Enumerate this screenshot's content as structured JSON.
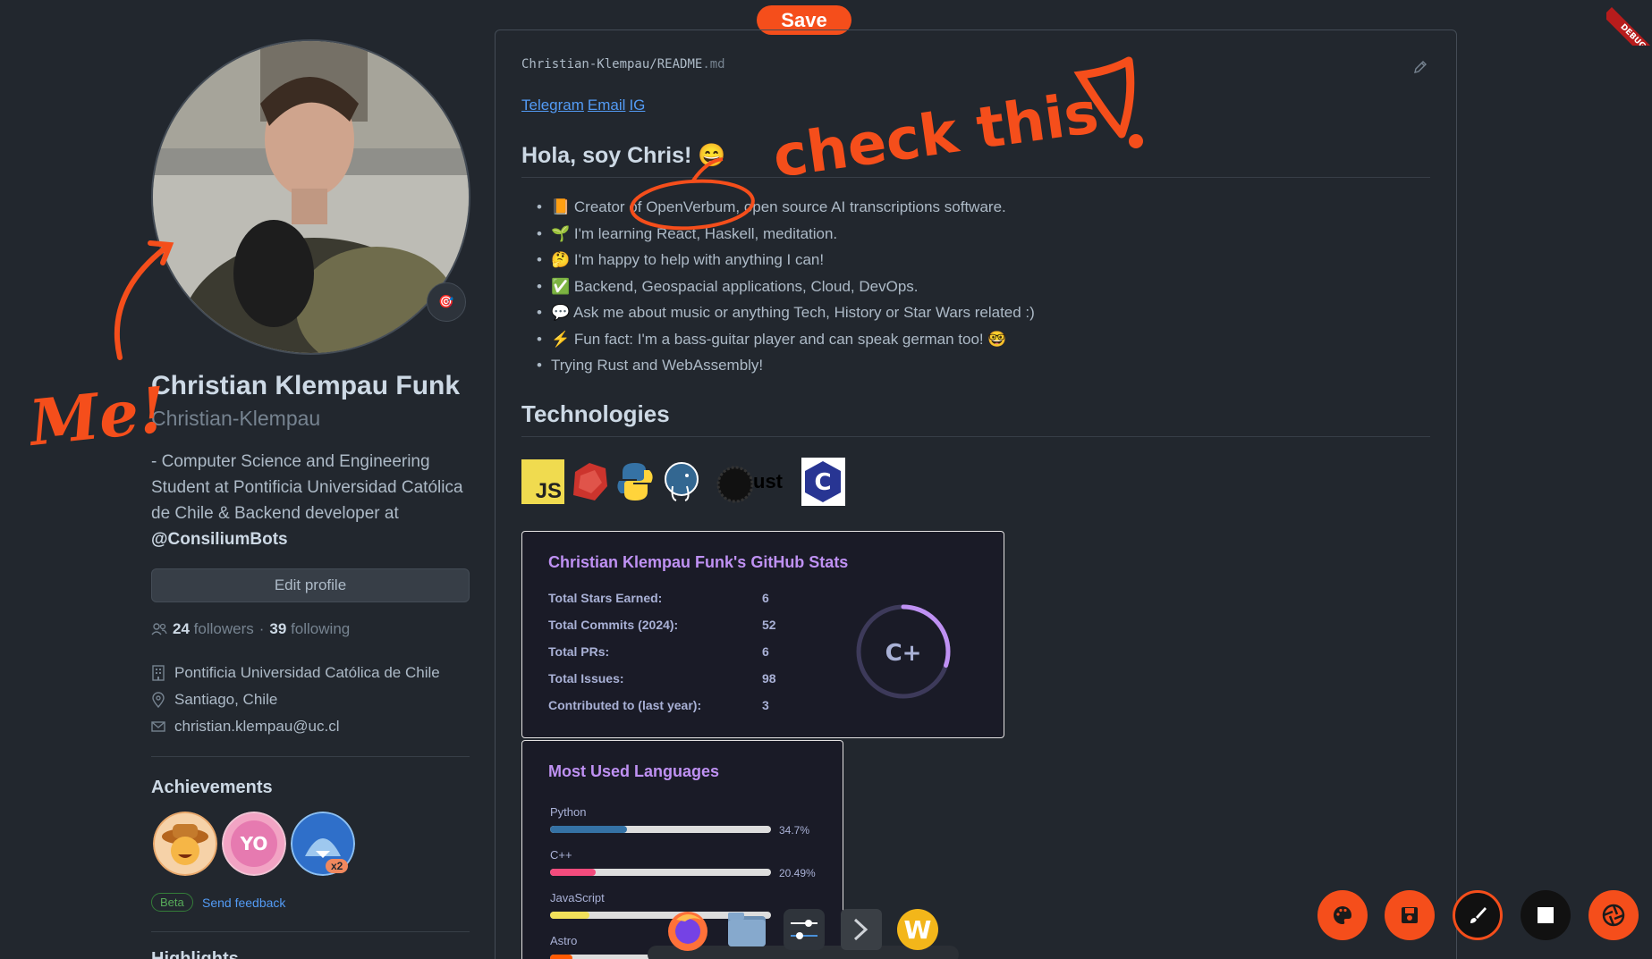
{
  "toolbar": {
    "save_label": "Save"
  },
  "profile": {
    "full_name": "Christian Klempau Funk",
    "username": "Christian-Klempau",
    "bio_text": "- Computer Science and Engineering Student at Pontificia Universidad Católica de Chile & Backend developer at ",
    "bio_org": "@ConsiliumBots",
    "edit_label": "Edit profile",
    "followers_count": "24",
    "followers_label": "followers",
    "separator": "·",
    "following_count": "39",
    "following_label": "following",
    "organization": "Pontificia Universidad Católica de Chile",
    "location": "Santiago, Chile",
    "email": "christian.klempau@uc.cl",
    "achievements_title": "Achievements",
    "achievement_multiplier": "x2",
    "beta_label": "Beta",
    "feedback_label": "Send feedback",
    "highlights_title": "Highlights"
  },
  "readme": {
    "path_owner": "Christian-Klempau",
    "path_sep": "/",
    "path_file": "README",
    "path_ext": ".md",
    "links": [
      "Telegram",
      "Email",
      "IG"
    ],
    "heading": "Hola, soy Chris! 😄",
    "bullets": [
      "📙 Creator of OpenVerbum, open source AI transcriptions software.",
      "🌱 I'm learning React, Haskell, meditation.",
      "🤔 I'm happy to help with anything I can!",
      "✅ Backend, Geospacial applications, Cloud, DevOps.",
      "💬 Ask me about music or anything Tech, History or Star Wars related :)",
      "⚡ Fun fact: I'm a bass-guitar player and can speak german too! 🤓",
      "Trying Rust and WebAssembly!"
    ],
    "tech_heading": "Technologies",
    "tech_labels": {
      "js": "JS",
      "rust": "ust"
    }
  },
  "stats": {
    "title": "Christian Klempau Funk's GitHub Stats",
    "rows": [
      {
        "label": "Total Stars Earned:",
        "value": "6"
      },
      {
        "label": "Total Commits (2024):",
        "value": "52"
      },
      {
        "label": "Total PRs:",
        "value": "6"
      },
      {
        "label": "Total Issues:",
        "value": "98"
      },
      {
        "label": "Contributed to (last year):",
        "value": "3"
      }
    ],
    "grade": "C+",
    "grade_progress": 0.3,
    "colors": {
      "title": "#bf91f3",
      "text": "#a9b1d6",
      "bg": "#1a1b27"
    }
  },
  "languages": {
    "title": "Most Used Languages",
    "items": [
      {
        "name": "Python",
        "percent": "34.7%",
        "value": 34.7,
        "color": "#3572A5"
      },
      {
        "name": "C++",
        "percent": "20.49%",
        "value": 20.49,
        "color": "#f34b7d"
      },
      {
        "name": "JavaScript",
        "percent": "",
        "value": 18,
        "color": "#f1e05a"
      },
      {
        "name": "Astro",
        "percent": "",
        "value": 10,
        "color": "#ff5a03"
      }
    ]
  },
  "annotations": {
    "check_text": "check this",
    "me_text": "Me!",
    "debug_text": "DEBUG",
    "color": "#f54e1b"
  },
  "tools": [
    "palette-icon",
    "save-icon",
    "brush-icon",
    "stop-icon",
    "shutter-icon"
  ],
  "dock": [
    "firefox-icon",
    "files-icon",
    "settings-icon",
    "terminal-icon",
    "w-app-icon"
  ],
  "dock_labels": {
    "w_app": "W"
  },
  "avatar_badge": "🎯"
}
